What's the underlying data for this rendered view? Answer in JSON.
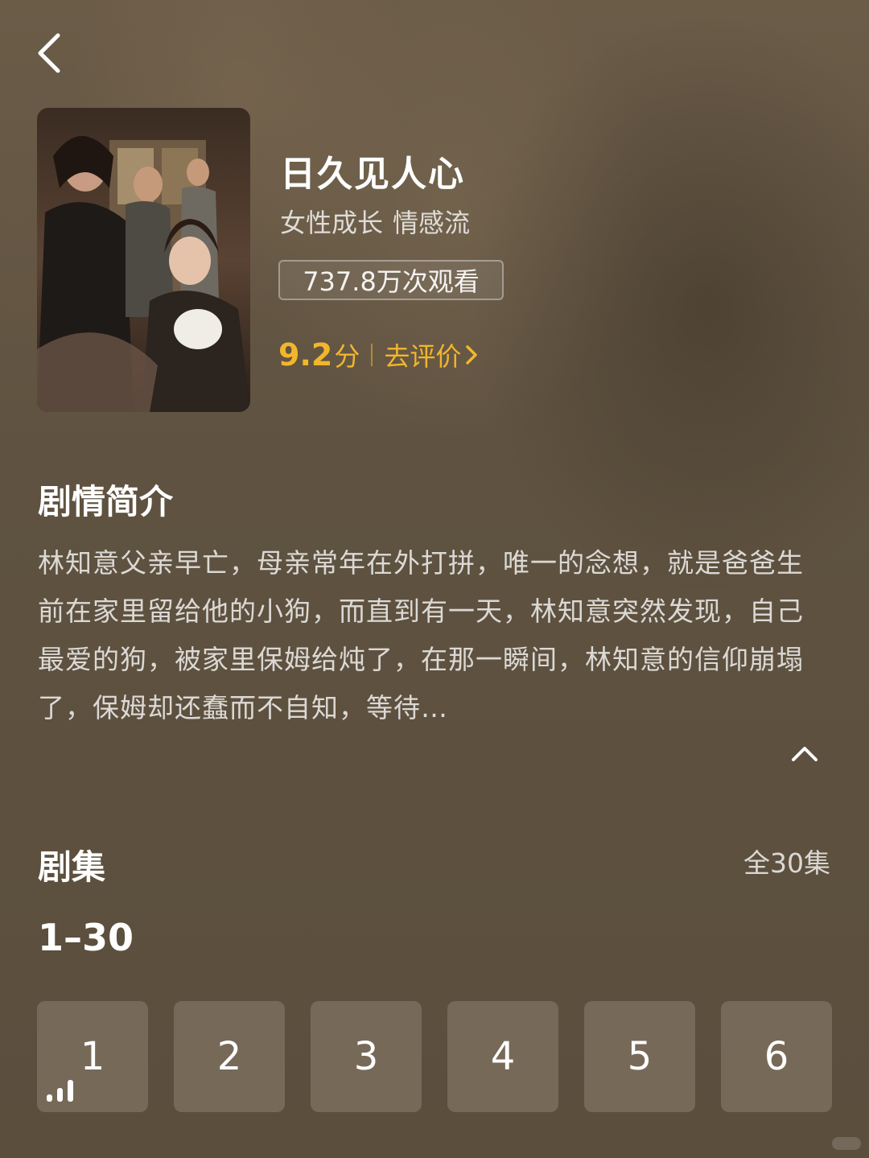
{
  "header": {
    "back_icon": "chevron-left-icon"
  },
  "drama": {
    "poster_title": "日久见人心",
    "title": "日久见人心",
    "tags": [
      "女性成长",
      "情感流"
    ],
    "views": "737.8万次观看",
    "score": "9.2",
    "score_unit": "分",
    "rate_label": "去评价",
    "rating_color": "#f2b62c"
  },
  "synopsis": {
    "heading": "剧情简介",
    "text": "林知意父亲早亡，母亲常年在外打拼，唯一的念想，就是爸爸生前在家里留给他的小狗，而直到有一天，林知意突然发现，自己最爱的狗，被家里保姆给炖了，在那一瞬间，林知意的信仰崩塌了，保姆却还蠢而不自知，等待…",
    "collapse_icon": "chevron-up-icon"
  },
  "episodes": {
    "heading": "剧集",
    "total": "全30集",
    "range": "1–30",
    "items": [
      "1",
      "2",
      "3",
      "4",
      "5",
      "6"
    ],
    "playing_index": 0
  }
}
